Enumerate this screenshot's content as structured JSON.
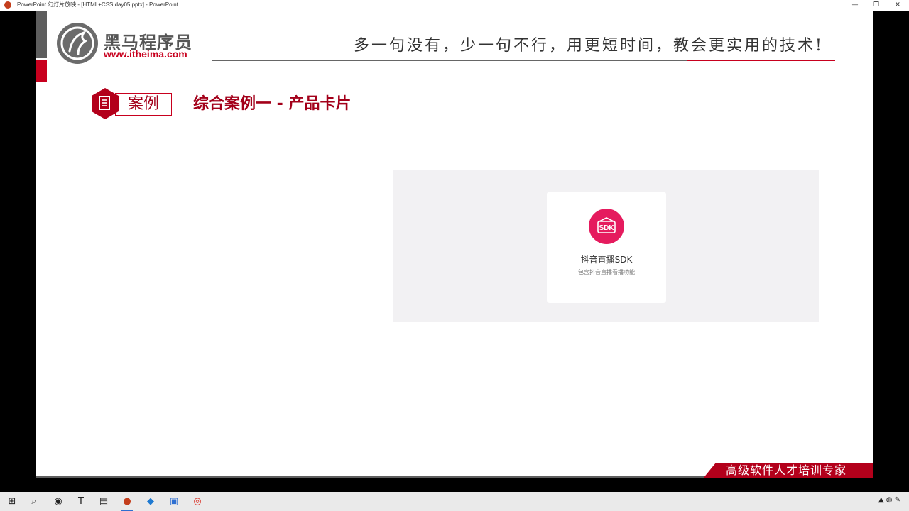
{
  "window": {
    "title": "PowerPoint 幻灯片放映 - [HTML+CSS day05.pptx] - PowerPoint",
    "minimize": "—",
    "maximize": "❐",
    "close": "✕"
  },
  "header": {
    "logo_name": "黑马程序员",
    "logo_url": "www.itheima.com",
    "slogan": "多一句没有，少一句不行，用更短时间，教会更实用的技术!"
  },
  "section": {
    "badge_label": "案例",
    "title": "综合案例一 - 产品卡片"
  },
  "card": {
    "icon_text": "SDK",
    "title": "抖音直播SDK",
    "description": "包含抖音直播看播功能"
  },
  "banner": {
    "text": "高级软件人才培训专家"
  },
  "colors": {
    "brand_red": "#c8001e",
    "dark_red": "#a3001a",
    "sdk_pink": "#e51b5e",
    "demo_bg": "#f2f1f3"
  },
  "taskbar": {
    "items": [
      "start-icon",
      "search-icon",
      "obs-icon",
      "typora-icon",
      "file-explorer-icon",
      "powerpoint-icon",
      "vscode-icon",
      "app-icon",
      "chrome-icon"
    ]
  }
}
